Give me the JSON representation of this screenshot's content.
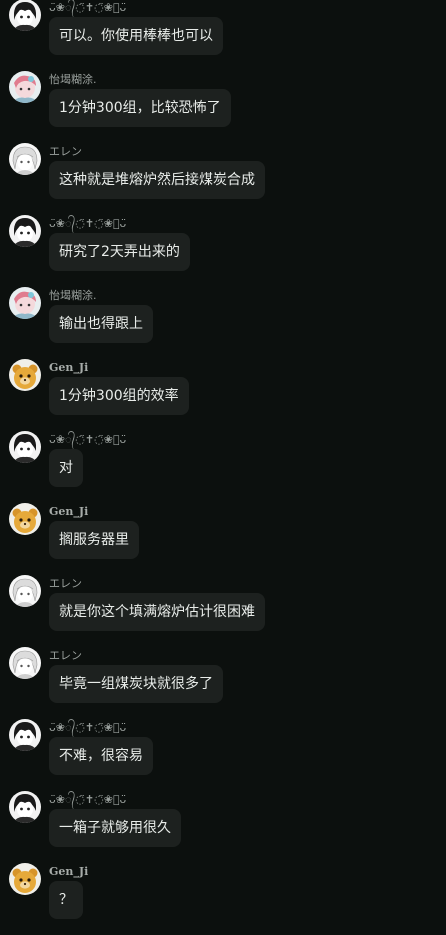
{
  "users": {
    "u1": {
      "name": "ᴗ̈❀᭄◌̈✝︎◌̈❀᭄ᴗ̈",
      "avatar_icon": "dark-hair-anime-avatar-icon"
    },
    "u2": {
      "name": "怡堨糊涂.",
      "avatar_icon": "pink-character-avatar-icon"
    },
    "u3": {
      "name": "エレン",
      "avatar_icon": "white-hair-anime-avatar-icon"
    },
    "u4": {
      "name": "Gen_Ji",
      "avatar_icon": "yellow-bear-avatar-icon"
    }
  },
  "messages": [
    {
      "user": "u1",
      "name": "ᴗ̈❀᭄◌̈✝︎◌̈❀᭄ᴗ̈",
      "text": "可以。你使用棒棒也可以"
    },
    {
      "user": "u2",
      "name": "怡堨糊涂.",
      "text": "1分钟300组，比较恐怖了"
    },
    {
      "user": "u3",
      "name": "エレン",
      "text": "这种就是堆熔炉然后接煤炭合成"
    },
    {
      "user": "u1",
      "name": "ᴗ̈❀᭄◌̈✝︎◌̈❀᭄ᴗ̈",
      "text": "研究了2天弄出来的"
    },
    {
      "user": "u2",
      "name": "怡堨糊涂.",
      "text": "输出也得跟上"
    },
    {
      "user": "u4",
      "name": "Gen_Ji",
      "text": "1分钟300组的效率"
    },
    {
      "user": "u1",
      "name": "ᴗ̈❀᭄◌̈✝︎◌̈❀᭄ᴗ̈",
      "text": "对"
    },
    {
      "user": "u4",
      "name": "Gen_Ji",
      "text": "搁服务器里"
    },
    {
      "user": "u3",
      "name": "エレン",
      "text": "就是你这个填满熔炉估计很困难"
    },
    {
      "user": "u3",
      "name": "エレン",
      "text": "毕竟一组煤炭块就很多了"
    },
    {
      "user": "u1",
      "name": "ᴗ̈❀᭄◌̈✝︎◌̈❀᭄ᴗ̈",
      "text": "不难，很容易"
    },
    {
      "user": "u1",
      "name": "ᴗ̈❀᭄◌̈✝︎◌̈❀᭄ᴗ̈",
      "text": "一箱子就够用很久"
    },
    {
      "user": "u4",
      "name": "Gen_Ji",
      "text": "？"
    }
  ]
}
